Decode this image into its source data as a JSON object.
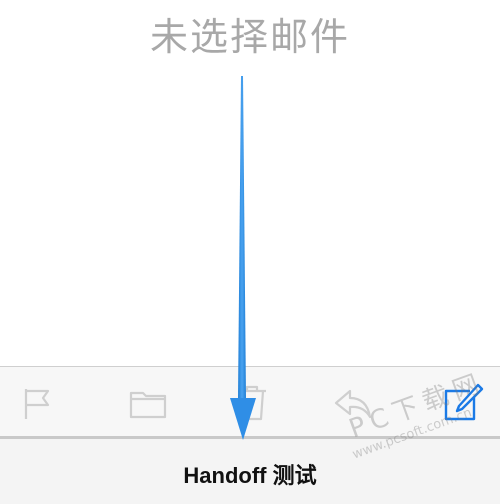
{
  "mailbox": {
    "empty_message": "未选择邮件"
  },
  "toolbar": {
    "buttons": [
      {
        "name": "flag",
        "icon": "flag-icon"
      },
      {
        "name": "move",
        "icon": "folder-icon"
      },
      {
        "name": "delete",
        "icon": "trash-icon"
      },
      {
        "name": "reply",
        "icon": "reply-icon"
      },
      {
        "name": "compose",
        "icon": "compose-icon"
      }
    ],
    "icon_color": "#cfcfcf",
    "accent_color": "#1b7ae6"
  },
  "handoff": {
    "label": "Handoff 测试"
  },
  "annotation": {
    "arrow_color": "#2f8ee6"
  },
  "watermark": {
    "text": "PC下载网",
    "url": "www.pcsoft.com.cn"
  }
}
